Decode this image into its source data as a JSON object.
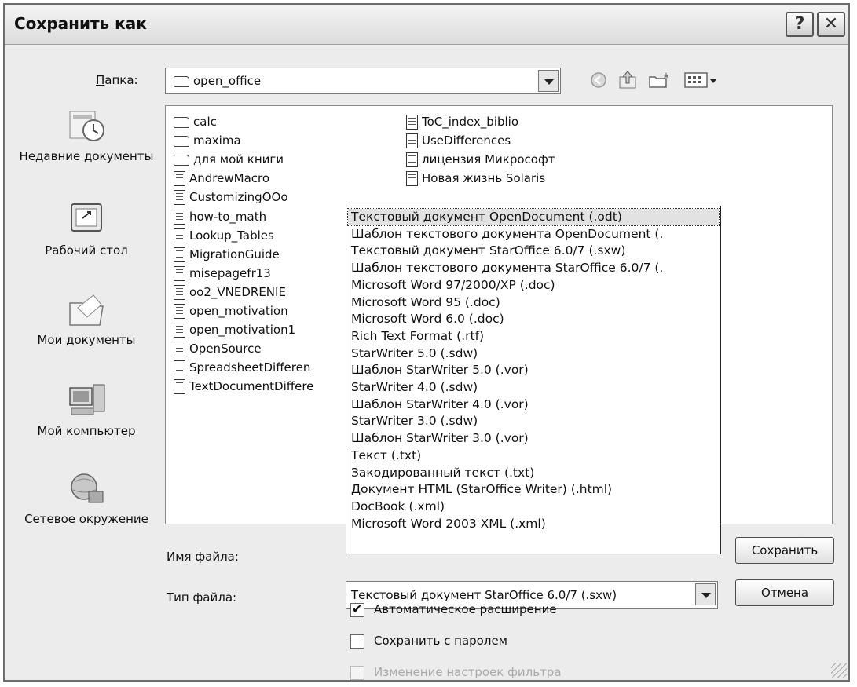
{
  "window": {
    "title": "Сохранить как",
    "help_label": "?",
    "close_label": "✕"
  },
  "toolbar": {
    "folder_label": "Папка:",
    "folder_value": "open_office",
    "icons": [
      "back-icon",
      "up-folder-icon",
      "new-folder-icon",
      "view-menu-icon"
    ]
  },
  "places": [
    {
      "label": "Недавние документы",
      "icon": "recent-documents-icon"
    },
    {
      "label": "Рабочий стол",
      "icon": "desktop-icon"
    },
    {
      "label": "Мои документы",
      "icon": "my-documents-icon"
    },
    {
      "label": "Мой компьютер",
      "icon": "my-computer-icon"
    },
    {
      "label": "Сетевое окружение",
      "icon": "network-icon"
    }
  ],
  "files": {
    "col1": [
      {
        "name": "calc",
        "type": "folder"
      },
      {
        "name": "maxima",
        "type": "folder"
      },
      {
        "name": "для мой книги",
        "type": "folder"
      },
      {
        "name": "AndrewMacro",
        "type": "doc"
      },
      {
        "name": "CustomizingOOo",
        "type": "doc"
      },
      {
        "name": "how-to_math",
        "type": "doc"
      },
      {
        "name": "Lookup_Tables",
        "type": "doc"
      },
      {
        "name": "MigrationGuide",
        "type": "doc"
      },
      {
        "name": "misepagefr13",
        "type": "doc"
      },
      {
        "name": "oo2_VNEDRENIE",
        "type": "doc"
      },
      {
        "name": "open_motivation",
        "type": "doc"
      },
      {
        "name": "open_motivation1",
        "type": "doc"
      },
      {
        "name": "OpenSource",
        "type": "doc"
      },
      {
        "name": "SpreadsheetDifferen",
        "type": "doc"
      },
      {
        "name": "TextDocumentDiffere",
        "type": "doc"
      }
    ],
    "col2": [
      {
        "name": "ToC_index_biblio",
        "type": "doc"
      },
      {
        "name": "UseDifferences",
        "type": "doc"
      },
      {
        "name": "лицензия Микрософт",
        "type": "doc"
      },
      {
        "name": "Новая жизнь Solaris",
        "type": "doc"
      }
    ]
  },
  "filetype_options": [
    "Текстовый документ OpenDocument (.odt)",
    "Шаблон текстового документа OpenDocument (.",
    "Текстовый документ StarOffice 6.0/7 (.sxw)",
    "Шаблон текстового документа StarOffice 6.0/7 (.",
    "Microsoft Word 97/2000/XP (.doc)",
    "Microsoft Word 95 (.doc)",
    "Microsoft Word 6.0 (.doc)",
    "Rich Text Format (.rtf)",
    "StarWriter 5.0 (.sdw)",
    "Шаблон StarWriter 5.0 (.vor)",
    "StarWriter 4.0 (.sdw)",
    "Шаблон StarWriter 4.0 (.vor)",
    "StarWriter 3.0 (.sdw)",
    "Шаблон StarWriter 3.0 (.vor)",
    "Текст (.txt)",
    "Закодированный текст (.txt)",
    "Документ HTML (StarOffice Writer) (.html)",
    "DocBook (.xml)",
    "Microsoft Word 2003 XML (.xml)"
  ],
  "form": {
    "filename_label": "Имя файла:",
    "filetype_label": "Тип файла:",
    "filetype_value": "Текстовый документ StarOffice 6.0/7 (.sxw)"
  },
  "buttons": {
    "save": "Сохранить",
    "cancel": "Отмена"
  },
  "options": {
    "auto_extension": {
      "label": "Автоматическое расширение",
      "checked": true
    },
    "save_password": {
      "label": "Сохранить с паролем",
      "checked": false
    },
    "edit_filter": {
      "label": "Изменение настроек фильтра",
      "checked": false,
      "disabled": true
    }
  }
}
